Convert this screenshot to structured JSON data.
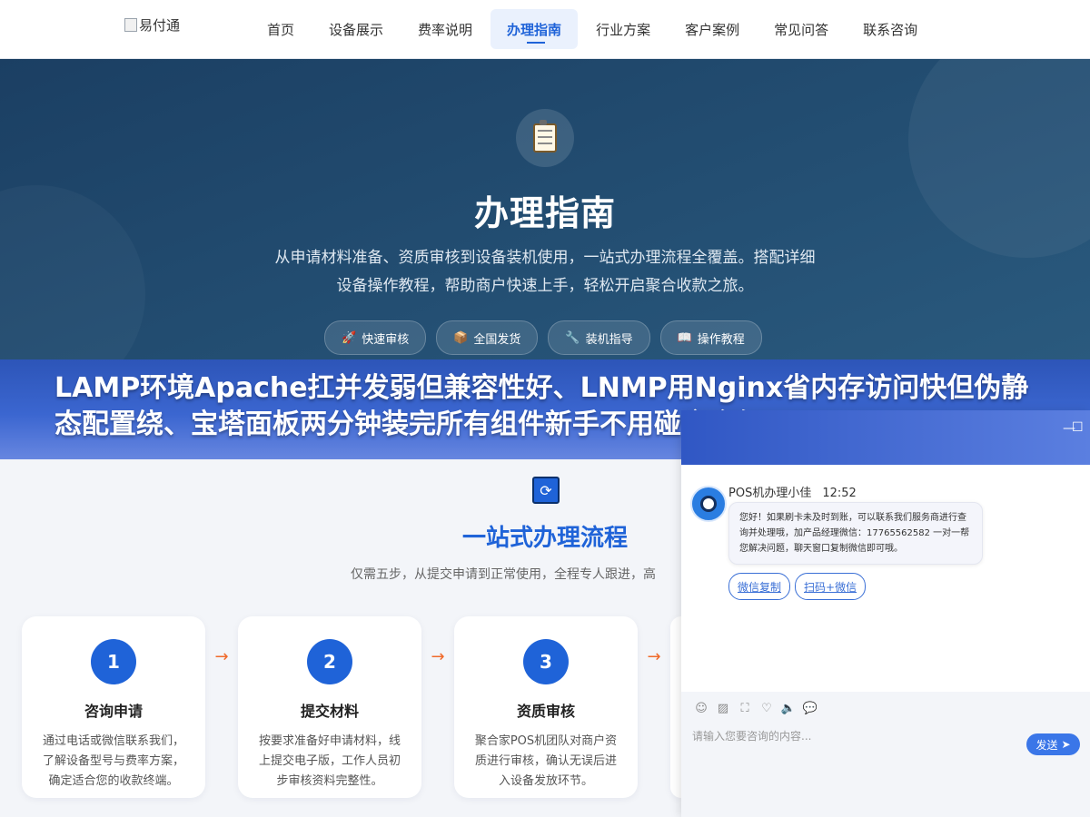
{
  "header": {
    "logo_alt": "易付通",
    "nav": [
      {
        "label": "首页"
      },
      {
        "label": "设备展示"
      },
      {
        "label": "费率说明"
      },
      {
        "label": "办理指南"
      },
      {
        "label": "行业方案"
      },
      {
        "label": "客户案例"
      },
      {
        "label": "常见问答"
      },
      {
        "label": "联系咨询"
      }
    ],
    "active_index": 3
  },
  "hero": {
    "icon": "clipboard-icon",
    "title": "办理指南",
    "description": "从申请材料准备、资质审核到设备装机使用，一站式办理流程全覆盖。搭配详细设备操作教程，帮助商户快速上手，轻松开启聚合收款之旅。",
    "tags": [
      {
        "icon": "rocket-icon",
        "glyph": "🚀",
        "label": "快速审核"
      },
      {
        "icon": "package-icon",
        "glyph": "📦",
        "label": "全国发货"
      },
      {
        "icon": "wrench-icon",
        "glyph": "🔧",
        "label": "装机指导"
      },
      {
        "icon": "book-icon",
        "glyph": "📖",
        "label": "操作教程"
      }
    ]
  },
  "banner": {
    "text": "LAMP环境Apache扛并发弱但兼容性好、LNMP用Nginx省内存访问快但伪静态配置绕、宝塔面板两分钟装完所有组件新手不用碰命令行、Doc"
  },
  "process": {
    "icon": "refresh-icon",
    "title": "一站式办理流程",
    "description": "仅需五步，从提交申请到正常使用，全程专人跟进，高",
    "steps": [
      {
        "num": "1",
        "title": "咨询申请",
        "desc": "通过电话或微信联系我们，了解设备型号与费率方案，确定适合您的收款终端。"
      },
      {
        "num": "2",
        "title": "提交材料",
        "desc": "按要求准备好申请材料，线上提交电子版，工作人员初步审核资料完整性。"
      },
      {
        "num": "3",
        "title": "资质审核",
        "desc": "聚合家POS机团队对商户资质进行审核，确认无误后进入设备发放环节。"
      }
    ],
    "arrow": "→"
  },
  "chat": {
    "agent_name": "POS机办理小佳",
    "time": "12:52",
    "message": "您好！如果刷卡未及时到账，可以联系我们服务商进行查询并处理哦，加产品经理微信：17765562582 一对一帮您解决问题，聊天窗口复制微信即可哦。",
    "quick_buttons": [
      "微信复制",
      "扫码+微信"
    ],
    "input_placeholder": "请输入您要咨询的内容...",
    "send_label": "发送",
    "minimize": "—",
    "maximize": "☐",
    "toolbar_icons": [
      {
        "name": "emoji-icon",
        "glyph": "☺"
      },
      {
        "name": "image-icon",
        "glyph": "▨"
      },
      {
        "name": "screenshot-icon",
        "glyph": "⛶"
      },
      {
        "name": "heart-icon",
        "glyph": "♡"
      },
      {
        "name": "volume-icon",
        "glyph": "🔈"
      },
      {
        "name": "chat-bubbles-icon",
        "glyph": "💬"
      }
    ]
  }
}
